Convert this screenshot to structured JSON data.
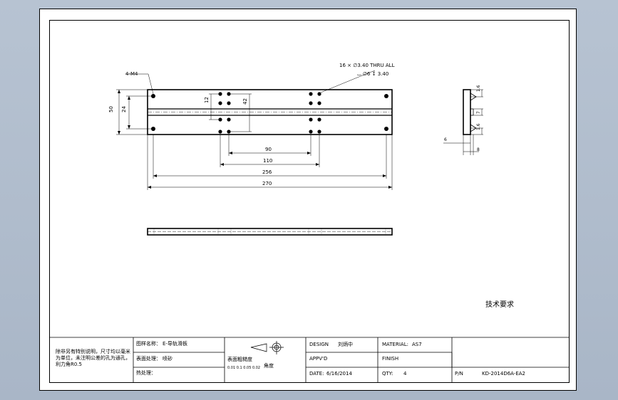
{
  "front_view": {
    "callout_tapped": "4-M4",
    "callout_holes_line1": "16 × ∅3.40 THRU ALL",
    "callout_holes_line2": "⌴ ∅6 ↧ 3.40",
    "dim_height_total": "50",
    "dim_height_hole": "24",
    "dim_hole_spacing_12": "12",
    "dim_hole_spacing_42": "42",
    "dim_90": "90",
    "dim_110": "110",
    "dim_256": "256",
    "dim_270": "270"
  },
  "side_view": {
    "dim_top": "1.6",
    "dim_mid": "7",
    "dim_bottom": "1.6",
    "dim_left": "6",
    "dim_right": "8"
  },
  "technical_requirements": "技术要求",
  "title_block": {
    "note": "除非另有特别说明，尺寸均以毫米为单位，未注明公差的孔为通孔，利力角R0.5",
    "part_name_label": "图样名称：",
    "part_name": "E-导轨滑板",
    "surface_label": "表面处理：",
    "surface": "喷砂",
    "process_label": "热处理：",
    "roughness_label": "表面粗糙度",
    "roughness_values": "0.01  0.1  0.05  0.02",
    "flatness_label": "角度",
    "design_label": "DESIGN",
    "designer": "刘炳中",
    "approved_label": "APPV'D",
    "date_label": "DATE:",
    "date": "6/16/2014",
    "material_label": "MATERIAL:",
    "material": "AS7",
    "finish_label": "FINISH",
    "qty_label": "QTY:",
    "qty": "4",
    "pn_label": "P/N",
    "pn": "KD-2014D6A-EA2"
  }
}
